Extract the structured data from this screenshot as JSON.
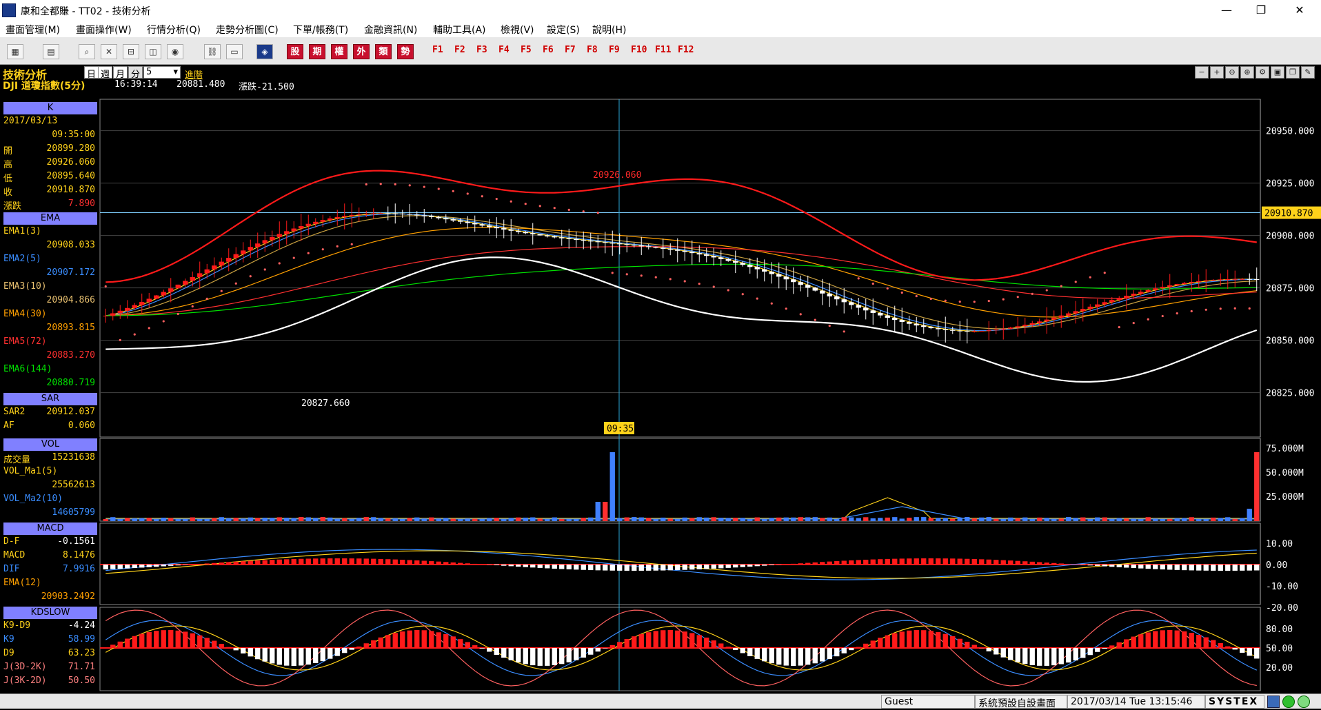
{
  "window": {
    "title": "康和全都賺 - TT02 - 技術分析",
    "min_label": "—",
    "restore_label": "❐",
    "close_label": "✕"
  },
  "menu": [
    "畫面管理(M)",
    "畫面操作(W)",
    "行情分析(Q)",
    "走勢分析圖(C)",
    "下單/帳務(T)",
    "金融資訊(N)",
    "輔助工具(A)",
    "檢視(V)",
    "設定(S)",
    "說明(H)"
  ],
  "toolbar": {
    "red_buttons": [
      "股",
      "期",
      "權",
      "外",
      "類",
      "勢"
    ],
    "fkeys": [
      "F1",
      "F2",
      "F3",
      "F4",
      "F5",
      "F6",
      "F7",
      "F8",
      "F9",
      "F10",
      "F11",
      "F12"
    ]
  },
  "info": {
    "title": "技術分析",
    "symbol": "DJI  道瓊指數(5分)",
    "time": "16:39:14",
    "price": "20881.480",
    "change": "漲跌-21.500",
    "tabs": [
      "日",
      "週",
      "月",
      "分"
    ],
    "period": "5",
    "advanced": "進階"
  },
  "left_panel": {
    "k_header": "K",
    "date": "2017/03/13",
    "time": "09:35:00",
    "open_label": "開",
    "open": "20899.280",
    "high_label": "高",
    "high": "20926.060",
    "low_label": "低",
    "low": "20895.640",
    "close_label": "收",
    "close": "20910.870",
    "chg_label": "漲跌",
    "chg": "7.890",
    "ema_header": "EMA",
    "ema1_label": "EMA1(3)",
    "ema1": "20908.033",
    "ema2_label": "EMA2(5)",
    "ema2": "20907.172",
    "ema3_label": "EMA3(10)",
    "ema3": "20904.866",
    "ema4_label": "EMA4(30)",
    "ema4": "20893.815",
    "ema5_label": "EMA5(72)",
    "ema5": "20883.270",
    "ema6_label": "EMA6(144)",
    "ema6": "20880.719",
    "sar_header": "SAR",
    "sar2_label": "SAR2",
    "sar2": "20912.037",
    "af_label": "AF",
    "af": "0.060",
    "vol_header": "VOL",
    "vol_label": "成交量",
    "vol": "15231638",
    "volma1_label": "VOL_Ma1(5)",
    "volma1": "25562613",
    "volma2_label": "VOL_Ma2(10)",
    "volma2": "14605799",
    "macd_header": "MACD",
    "df_label": "D-F",
    "df": "-0.1561",
    "macd_label": "MACD",
    "macd": "8.1476",
    "dif_label": "DIF",
    "dif": "7.9916",
    "ema12_label": "EMA(12)",
    "ema12": "20903.2492",
    "kd_header": "KDSLOW",
    "k9d9_label": "K9-D9",
    "k9d9": "-4.24",
    "k9_label": "K9",
    "k9": "58.99",
    "d9_label": "D9",
    "d9": "63.23",
    "j1_label": "J(3D-2K)",
    "j1": "71.71",
    "j2_label": "J(3K-2D)",
    "j2": "50.50"
  },
  "colors": {
    "ema1": "#ffd21a",
    "ema2": "#3a8dff",
    "ema3": "#ffd21a",
    "ema4": "#ffa000",
    "ema5": "#ff3030",
    "ema6": "#00e000",
    "up": "#ff1a1a",
    "down": "#ffffff",
    "grid": "#444444",
    "axis_text": "#ffffff",
    "current_price_bg": "#ffd21a"
  },
  "chart_data": {
    "type": "candlestick",
    "price_axis": {
      "ticks": [
        "20950.000",
        "20925.000",
        "20900.000",
        "20875.000",
        "20850.000",
        "20825.000"
      ],
      "ylim": [
        20815,
        20965
      ]
    },
    "current_price_label": "20910.870",
    "high_label": "20926.060",
    "low_label": "20827.660",
    "cursor_time": "09:35",
    "vol_axis": {
      "ticks": [
        "75.000M",
        "50.000M",
        "25.000M"
      ]
    },
    "macd_axis": {
      "ticks": [
        "10.00",
        "0.00",
        "-10.00",
        "-20.00"
      ]
    },
    "kd_axis": {
      "ticks": [
        "80.00",
        "50.00",
        "20.00"
      ]
    }
  },
  "status": {
    "user": "Guest",
    "screen": "系統預設自設畫面",
    "datetime": "2017/03/14 Tue 13:15:46",
    "brand": "SYSTEX"
  }
}
